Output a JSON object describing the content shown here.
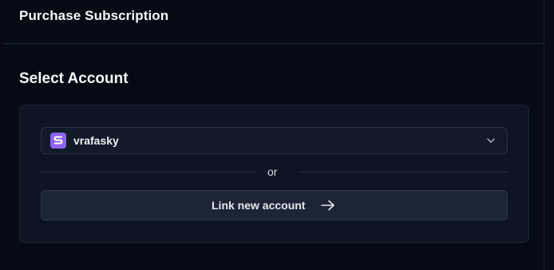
{
  "header": {
    "title": "Purchase Subscription"
  },
  "section": {
    "title": "Select Account"
  },
  "account_select": {
    "selected": "vrafasky",
    "logo_icon": "letter-s-logo",
    "accent_color": "#8b63f0"
  },
  "divider": {
    "text": "or"
  },
  "link_button": {
    "label": "Link new account",
    "icon": "arrow-right-icon"
  },
  "colors": {
    "background": "#060a14",
    "card": "#0d1422",
    "button": "#1c2534"
  }
}
